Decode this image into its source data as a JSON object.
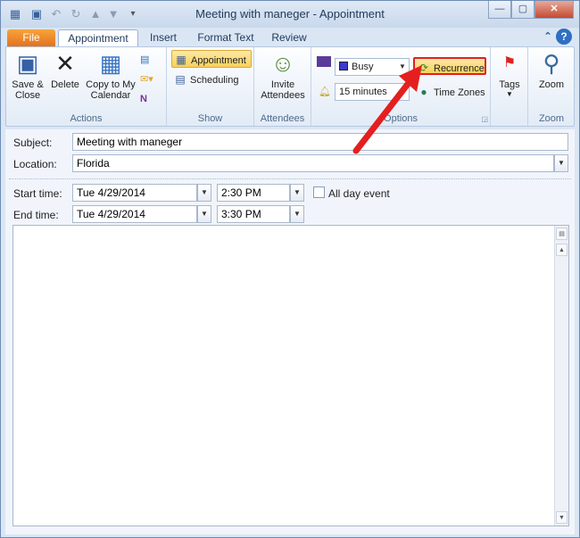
{
  "window": {
    "title": "Meeting with maneger - Appointment"
  },
  "tabs": [
    {
      "label": "File"
    },
    {
      "label": "Appointment"
    },
    {
      "label": "Insert"
    },
    {
      "label": "Format Text"
    },
    {
      "label": "Review"
    }
  ],
  "ribbon": {
    "actions": {
      "label": "Actions",
      "save_close": "Save &\nClose",
      "delete": "Delete",
      "copy_calendar": "Copy to My\nCalendar"
    },
    "show": {
      "label": "Show",
      "appointment": "Appointment",
      "scheduling": "Scheduling"
    },
    "attendees": {
      "label": "Attendees",
      "invite": "Invite\nAttendees"
    },
    "options": {
      "label": "Options",
      "show_as": "Busy",
      "reminder": "15 minutes",
      "recurrence": "Recurrence",
      "time_zones": "Time Zones"
    },
    "tags": {
      "label": "Tags"
    },
    "zoom": {
      "label": "Zoom",
      "zoom_btn": "Zoom"
    }
  },
  "form": {
    "subject_label": "Subject:",
    "subject_value": "Meeting with maneger",
    "location_label": "Location:",
    "location_value": "Florida",
    "start_label": "Start time:",
    "start_date": "Tue 4/29/2014",
    "start_time": "2:30 PM",
    "all_day": "All day event",
    "end_label": "End time:",
    "end_date": "Tue 4/29/2014",
    "end_time": "3:30 PM"
  },
  "colors": {
    "accent": "#e2701a",
    "highlight": "#f8d05e",
    "arrow": "#e41f1f"
  }
}
